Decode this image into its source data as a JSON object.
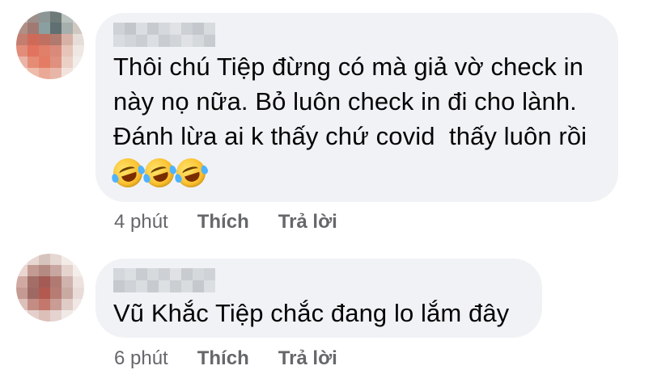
{
  "comments": [
    {
      "text_lines": [
        "Thôi chú Tiệp đừng có mà giả vờ check in",
        "này nọ nữa. Bỏ luôn check in đi cho lành.",
        "Đánh lừa ai k thấy chứ covid  thấy luôn rồi"
      ],
      "reactions_icon": "rolling-on-floor-laughing-icon",
      "time": "4 phút",
      "like_label": "Thích",
      "reply_label": "Trả lời"
    },
    {
      "text_lines": [
        "Vũ Khắc Tiệp chắc đang lo lắm đây"
      ],
      "time": "6 phút",
      "like_label": "Thích",
      "reply_label": "Trả lời"
    }
  ],
  "colors": {
    "bubble": "#f0f2f5",
    "text": "#050505",
    "meta": "#65676b"
  }
}
